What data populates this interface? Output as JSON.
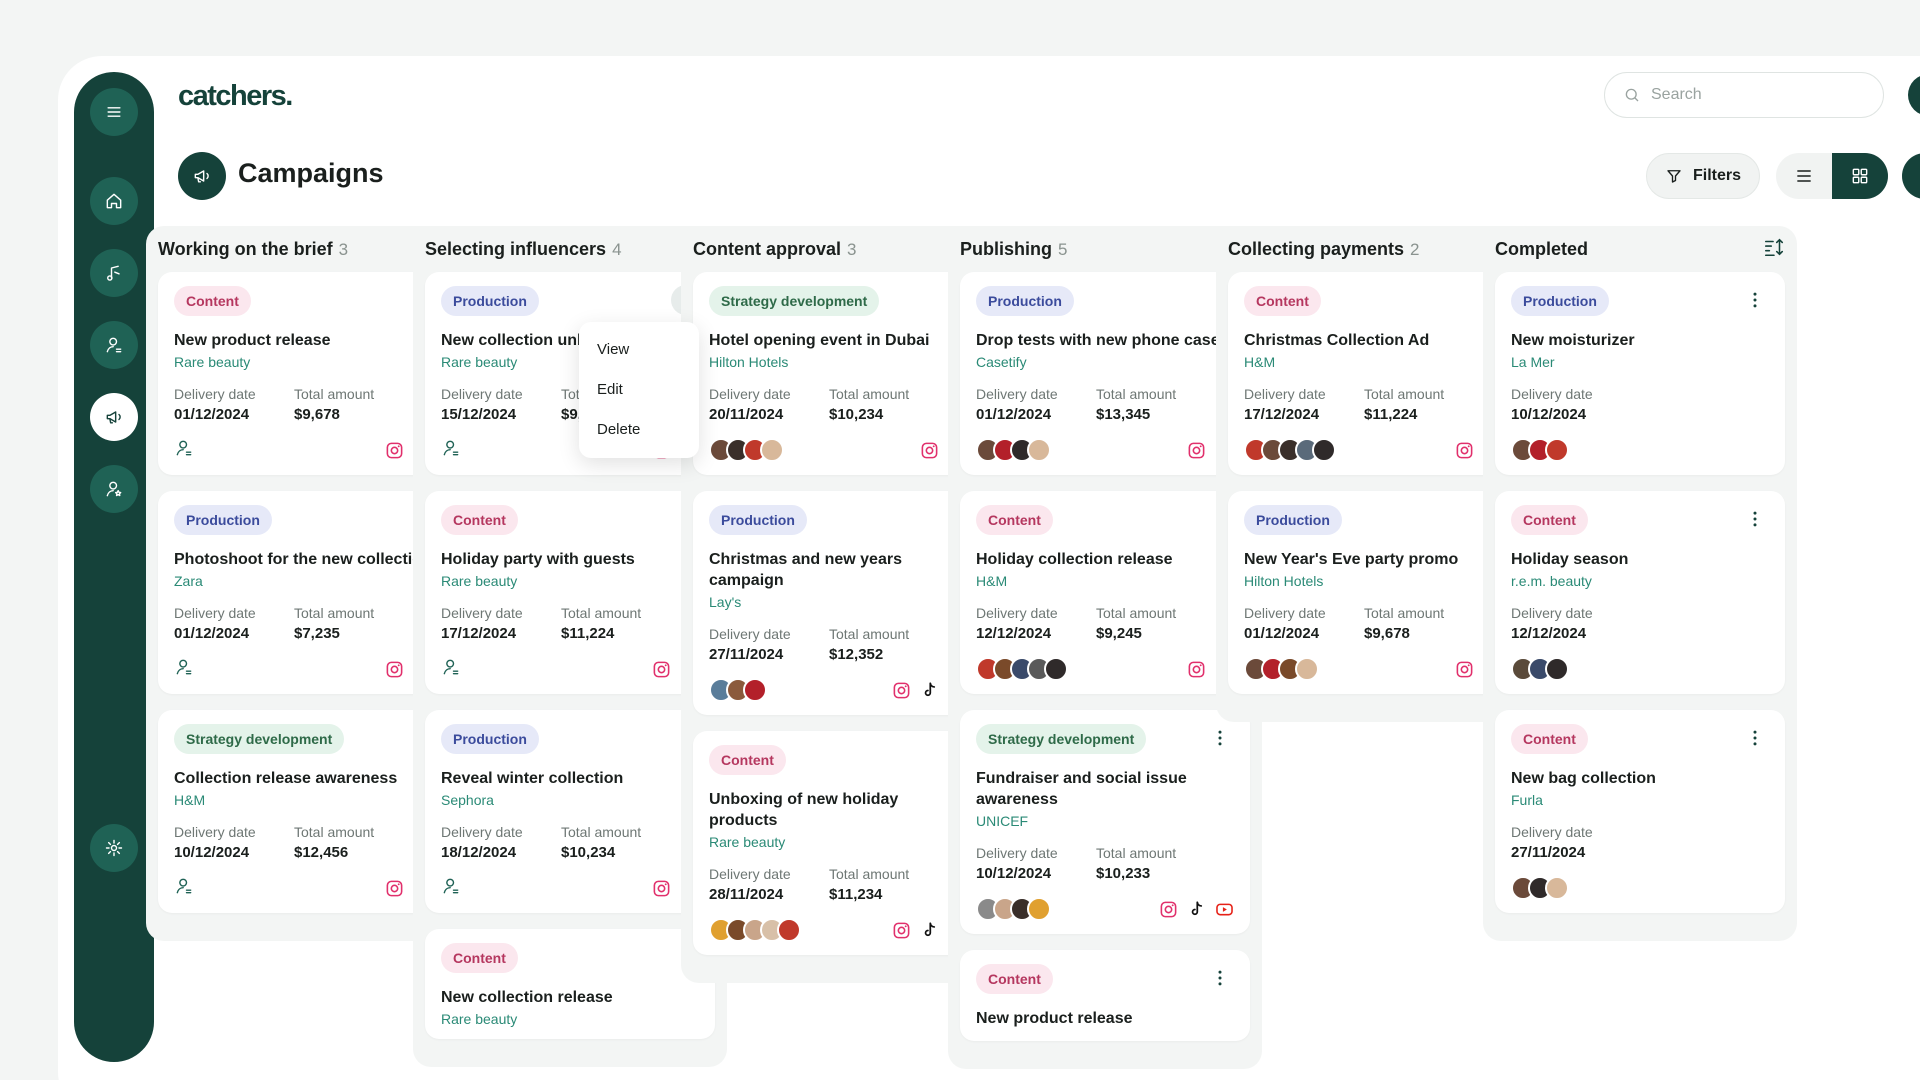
{
  "app": {
    "logo": "catchers."
  },
  "search": {
    "placeholder": "Search"
  },
  "page": {
    "title": "Campaigns"
  },
  "toolbar": {
    "filters_label": "Filters"
  },
  "menu": {
    "items": [
      "View",
      "Edit",
      "Delete"
    ]
  },
  "labels": {
    "delivery": "Delivery date",
    "total": "Total amount"
  },
  "colors": {
    "primary": "#15423a",
    "accent": "#2a8a76",
    "content_tag": "#b5375f",
    "production_tag": "#3b4b9c",
    "strategy_tag": "#2e6a48"
  },
  "columns": [
    {
      "title": "Working on the brief",
      "count": "3",
      "cards": [
        {
          "tag": "Content",
          "title": "New product release",
          "brand": "Rare beauty",
          "date": "01/12/2024",
          "amount": "$9,678",
          "foot": "user",
          "avatars": [],
          "socials": [
            "instagram",
            "tiktok"
          ]
        },
        {
          "tag": "Production",
          "title": "Photoshoot for the new collection",
          "brand": "Zara",
          "date": "01/12/2024",
          "amount": "$7,235",
          "foot": "user",
          "avatars": [],
          "socials": [
            "instagram",
            "tiktok"
          ]
        },
        {
          "tag": "Strategy development",
          "title": "Collection release awareness",
          "brand": "H&M",
          "date": "10/12/2024",
          "amount": "$12,456",
          "foot": "user",
          "avatars": [],
          "socials": [
            "instagram",
            "tiktok"
          ]
        }
      ]
    },
    {
      "title": "Selecting influencers",
      "count": "4",
      "cards": [
        {
          "tag": "Production",
          "title": "New collection unb",
          "brand": "Rare beauty",
          "date": "15/12/2024",
          "amount": "$9,6",
          "foot": "user",
          "avatars": [],
          "socials": [
            "instagram",
            "tiktok"
          ],
          "menu_open": true
        },
        {
          "tag": "Content",
          "title": "Holiday party with guests",
          "brand": "Rare beauty",
          "date": "17/12/2024",
          "amount": "$11,224",
          "foot": "user",
          "avatars": [],
          "socials": [
            "instagram",
            "tiktok"
          ]
        },
        {
          "tag": "Production",
          "title": "Reveal winter collection",
          "brand": "Sephora",
          "date": "18/12/2024",
          "amount": "$10,234",
          "foot": "user",
          "avatars": [],
          "socials": [
            "instagram",
            "tiktok"
          ]
        },
        {
          "tag": "Content",
          "title": "New collection release",
          "brand": "Rare beauty",
          "date": "",
          "amount": "",
          "foot": "none",
          "avatars": [],
          "socials": []
        }
      ]
    },
    {
      "title": "Content approval",
      "count": "3",
      "cards": [
        {
          "tag": "Strategy development",
          "title": "Hotel opening event in Dubai",
          "brand": "Hilton Hotels",
          "date": "20/11/2024",
          "amount": "$10,234",
          "foot": "avatars",
          "avatars": [
            "#6b4a3a",
            "#3a2f2a",
            "#c0392b",
            "#d8b89a"
          ],
          "socials": [
            "instagram",
            "tiktok"
          ]
        },
        {
          "tag": "Production",
          "title": "Christmas and new years campaign",
          "brand": "Lay's",
          "date": "27/11/2024",
          "amount": "$12,352",
          "foot": "avatars",
          "avatars": [
            "#5a7d9a",
            "#8b5a3c",
            "#b3202a"
          ],
          "socials": [
            "instagram",
            "tiktok",
            "youtube"
          ]
        },
        {
          "tag": "Content",
          "title": "Unboxing of new holiday products",
          "brand": "Rare beauty",
          "date": "28/11/2024",
          "amount": "$11,234",
          "foot": "avatars",
          "avatars": [
            "#e0a030",
            "#7a4a2a",
            "#c9a58a",
            "#d8c0a8",
            "#c0392b"
          ],
          "socials": [
            "instagram",
            "tiktok",
            "youtube"
          ]
        }
      ]
    },
    {
      "title": "Publishing",
      "count": "5",
      "cards": [
        {
          "tag": "Production",
          "title": "Drop tests with new phone cases",
          "brand": "Casetify",
          "date": "01/12/2024",
          "amount": "$13,345",
          "foot": "avatars",
          "avatars": [
            "#6b4a3a",
            "#b3202a",
            "#2f2a2a",
            "#d8b89a"
          ],
          "socials": [
            "instagram",
            "tiktok"
          ]
        },
        {
          "tag": "Content",
          "title": "Holiday collection release",
          "brand": "H&M",
          "date": "12/12/2024",
          "amount": "$9,245",
          "foot": "avatars",
          "avatars": [
            "#c0392b",
            "#7a4a2a",
            "#3a4a6a",
            "#5a5a5a",
            "#2f2a2a"
          ],
          "socials": [
            "instagram",
            "snapchat"
          ]
        },
        {
          "tag": "Strategy development",
          "title": "Fundraiser and social issue awareness",
          "brand": "UNICEF",
          "date": "10/12/2024",
          "amount": "$10,233",
          "foot": "avatars",
          "avatars": [
            "#8a8a8a",
            "#c9a58a",
            "#3a2f2a",
            "#e0a030"
          ],
          "socials": [
            "instagram",
            "tiktok",
            "youtube"
          ]
        },
        {
          "tag": "Content",
          "title": "New product release",
          "brand": "",
          "date": "",
          "amount": "",
          "foot": "none",
          "avatars": [],
          "socials": []
        }
      ]
    },
    {
      "title": "Collecting payments",
      "count": "2",
      "cards": [
        {
          "tag": "Content",
          "title": "Christmas Collection Ad",
          "brand": "H&M",
          "date": "17/12/2024",
          "amount": "$11,224",
          "foot": "avatars",
          "avatars": [
            "#c0392b",
            "#6b4a3a",
            "#3a2f2a",
            "#5a6a7a",
            "#2f2a2a"
          ],
          "socials": [
            "instagram",
            "snapchat"
          ]
        },
        {
          "tag": "Production",
          "title": "New Year's Eve party promo",
          "brand": "Hilton Hotels",
          "date": "01/12/2024",
          "amount": "$9,678",
          "foot": "avatars",
          "avatars": [
            "#6b4a3a",
            "#b3202a",
            "#7a4a2a",
            "#d8b89a"
          ],
          "socials": [
            "instagram",
            "tiktok"
          ]
        }
      ]
    },
    {
      "title": "Completed",
      "count": "",
      "cards": [
        {
          "tag": "Production",
          "title": "New moisturizer",
          "brand": "La Mer",
          "date": "10/12/2024",
          "amount": "",
          "foot": "avatars",
          "avatars": [
            "#6b4a3a",
            "#b3202a",
            "#c0392b"
          ],
          "socials": []
        },
        {
          "tag": "Content",
          "title": "Holiday season",
          "brand": "r.e.m. beauty",
          "date": "12/12/2024",
          "amount": "",
          "foot": "avatars",
          "avatars": [
            "#5a4a3a",
            "#3a4a6a",
            "#2f2a2a"
          ],
          "socials": []
        },
        {
          "tag": "Content",
          "title": "New bag collection",
          "brand": "Furla",
          "date": "27/11/2024",
          "amount": "",
          "foot": "avatars",
          "avatars": [
            "#6b4a3a",
            "#2f2a2a",
            "#d8b89a"
          ],
          "socials": []
        }
      ]
    }
  ]
}
